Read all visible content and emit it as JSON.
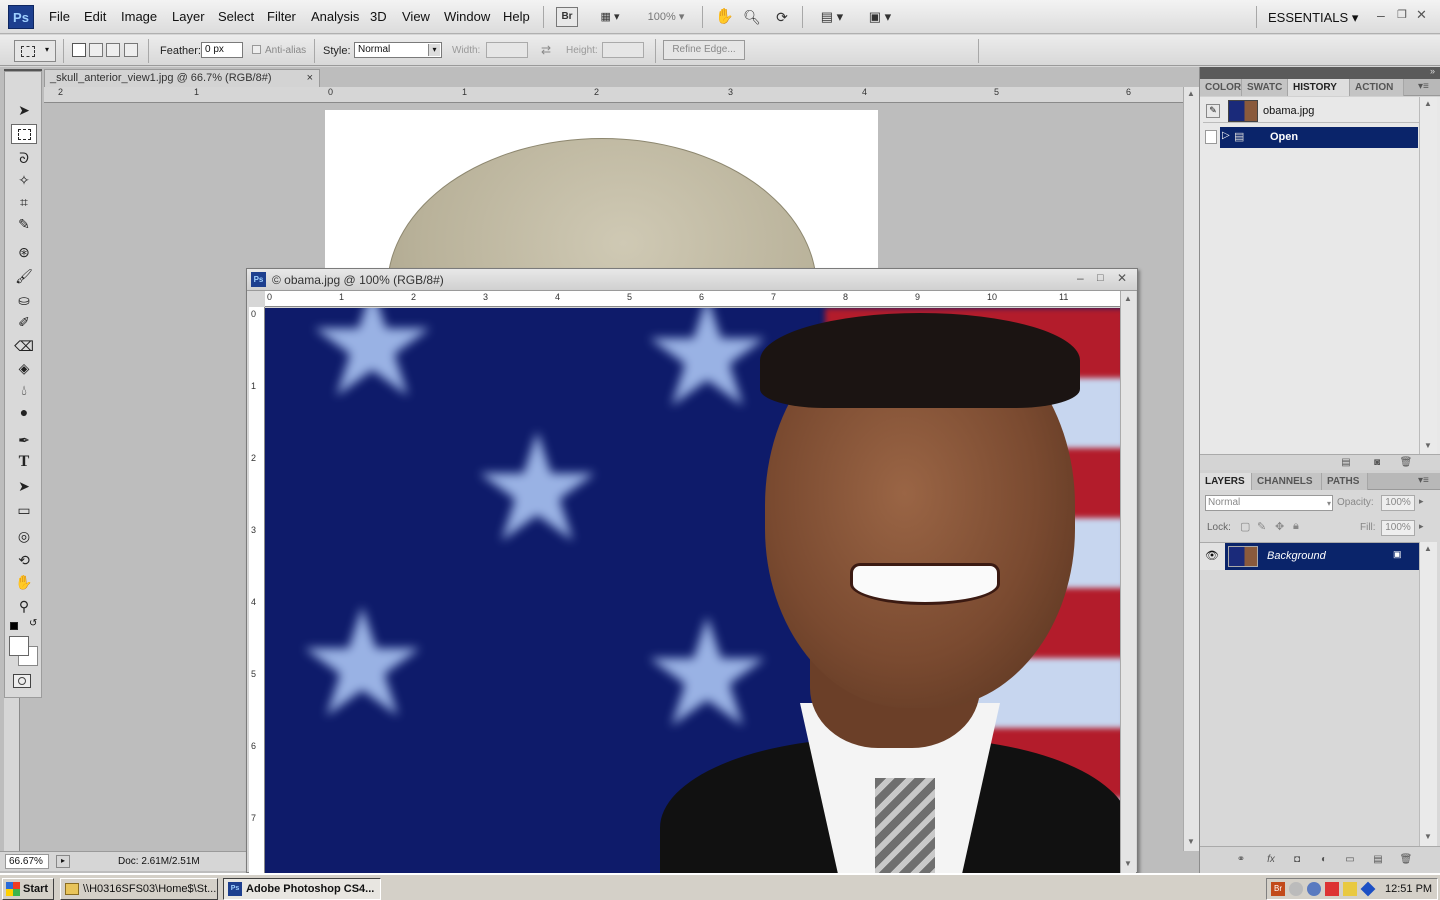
{
  "app": {
    "logo": "Ps",
    "workspace": "ESSENTIALS",
    "zoom_menu": "100%"
  },
  "menu": [
    "File",
    "Edit",
    "Image",
    "Layer",
    "Select",
    "Filter",
    "Analysis",
    "3D",
    "View",
    "Window",
    "Help"
  ],
  "options": {
    "feather_label": "Feather:",
    "feather_value": "0 px",
    "antialias": "Anti-alias",
    "style_label": "Style:",
    "style_value": "Normal",
    "width_label": "Width:",
    "height_label": "Height:",
    "refine": "Refine Edge..."
  },
  "doc_skull": {
    "tab": "_skull_anterior_view1.jpg @ 66.7% (RGB/8#)",
    "ruler": [
      "2",
      "1",
      "0",
      "1",
      "2",
      "3",
      "4",
      "5",
      "6"
    ]
  },
  "doc_obama": {
    "title": "© obama.jpg @ 100% (RGB/8#)",
    "ruler_h": [
      "0",
      "1",
      "2",
      "3",
      "4",
      "5",
      "6",
      "7",
      "8",
      "9",
      "10",
      "11"
    ],
    "ruler_v": [
      "0",
      "1",
      "2",
      "3",
      "4",
      "5",
      "6",
      "7"
    ]
  },
  "status": {
    "zoom": "66.67%",
    "doc": "Doc: 2.61M/2.51M"
  },
  "panels": {
    "tabs_top": [
      "COLOR",
      "SWATC",
      "HISTORY",
      "ACTION"
    ],
    "history": {
      "snapshot": "obama.jpg",
      "step": "Open"
    },
    "tabs_layers": [
      "LAYERS",
      "CHANNELS",
      "PATHS"
    ],
    "blend": "Normal",
    "opacity_label": "Opacity:",
    "opacity": "100%",
    "lock_label": "Lock:",
    "fill_label": "Fill:",
    "fill": "100%",
    "layer": "Background"
  },
  "taskbar": {
    "start": "Start",
    "item1": "\\\\H0316SFS03\\Home$\\St...",
    "item2": "Adobe Photoshop CS4...",
    "clock": "12:51 PM"
  },
  "colors": {
    "selection": "#0a246a",
    "flag_blue": "#0e1b6a",
    "stars": "#a9c3f2",
    "accent": "#1d3f8f"
  }
}
